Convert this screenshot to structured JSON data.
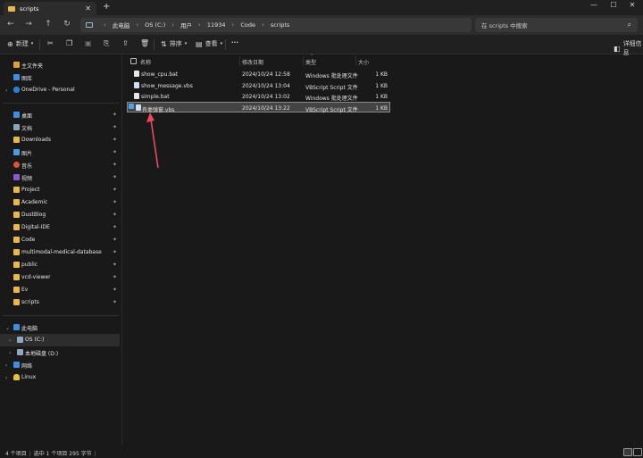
{
  "window": {
    "tab_title": "scripts",
    "new_tab": "+",
    "minimize": "—",
    "maximize": "☐",
    "close": "✕"
  },
  "nav": {
    "back": "←",
    "forward": "→",
    "up": "↑",
    "refresh": "↻"
  },
  "breadcrumb": [
    "此电脑",
    "OS (C:)",
    "用户",
    "11934",
    "Code",
    "scripts"
  ],
  "breadcrumb_sep": "›",
  "search": {
    "placeholder": "在 scripts 中搜索"
  },
  "toolbar": {
    "new_label": "新建",
    "sort_label": "排序",
    "view_label": "查看",
    "more_label": "···",
    "details_label": "详细信息"
  },
  "sidebar": {
    "quick": [
      {
        "label": "主文件夹",
        "icon": "home-icon",
        "color": "#e2a03a"
      },
      {
        "label": "图库",
        "icon": "gallery-icon",
        "color": "#3d8ee0"
      },
      {
        "label": "OneDrive - Personal",
        "icon": "cloud-icon",
        "color": "#2a7fd4"
      }
    ],
    "pinned": [
      {
        "label": "桌面",
        "icon": "desktop-icon",
        "color": "#3d8ee0"
      },
      {
        "label": "文档",
        "icon": "document-icon",
        "color": "#8aa3bf"
      },
      {
        "label": "Downloads",
        "icon": "folder-icon",
        "color": "#e8b84a"
      },
      {
        "label": "图片",
        "icon": "picture-icon",
        "color": "#4a9be0"
      },
      {
        "label": "音乐",
        "icon": "music-icon",
        "color": "#e0523a"
      },
      {
        "label": "视频",
        "icon": "video-icon",
        "color": "#8a5ad4"
      },
      {
        "label": "Project",
        "icon": "folder-icon",
        "color": "#e8b84a"
      },
      {
        "label": "Academic",
        "icon": "folder-icon",
        "color": "#e8b84a"
      },
      {
        "label": "DustBlog",
        "icon": "folder-icon",
        "color": "#e8b84a"
      },
      {
        "label": "Digital-IDE",
        "icon": "folder-icon",
        "color": "#e8b84a"
      },
      {
        "label": "Code",
        "icon": "folder-icon",
        "color": "#e8b84a"
      },
      {
        "label": "multimodal-medical-database",
        "icon": "folder-icon",
        "color": "#e8b84a"
      },
      {
        "label": "public",
        "icon": "folder-icon",
        "color": "#e8b84a"
      },
      {
        "label": "vcd-viewer",
        "icon": "folder-icon",
        "color": "#e8b84a"
      },
      {
        "label": "Ev",
        "icon": "folder-icon",
        "color": "#e8b84a"
      },
      {
        "label": "scripts",
        "icon": "folder-icon",
        "color": "#e8b84a"
      }
    ],
    "tree": [
      {
        "label": "此电脑",
        "icon": "pc-icon",
        "color": "#3d8ee0"
      },
      {
        "label": "OS (C:)",
        "icon": "drive-icon",
        "color": "#8fa8c0"
      },
      {
        "label": "本地磁盘 (D:)",
        "icon": "drive-icon",
        "color": "#8fa8c0"
      },
      {
        "label": "网络",
        "icon": "network-icon",
        "color": "#3d8ee0"
      },
      {
        "label": "Linux",
        "icon": "linux-icon",
        "color": "#e8c13a"
      }
    ],
    "pin_glyph": "📌"
  },
  "columns": {
    "name": "名称",
    "modified": "修改日期",
    "type": "类型",
    "size": "大小"
  },
  "files": [
    {
      "name": "show_cpu.bat",
      "modified": "2024/10/24 12:58",
      "type": "Windows 批处理文件",
      "size": "1 KB",
      "kind": "bat"
    },
    {
      "name": "show_message.vbs",
      "modified": "2024/10/24 13:04",
      "type": "VBScript Script 文件",
      "size": "1 KB",
      "kind": "vbs"
    },
    {
      "name": "simple.bat",
      "modified": "2024/10/24 13:02",
      "type": "Windows 批处理文件",
      "size": "1 KB",
      "kind": "bat"
    },
    {
      "name": "有类弹窗.vbs",
      "modified": "2024/10/24 13:22",
      "type": "VBScript Script 文件",
      "size": "1 KB",
      "kind": "vbs",
      "selected": true
    }
  ],
  "status": {
    "items": "4 个项目",
    "selection": "选中 1 个项目 295 字节"
  },
  "colors": {
    "accent": "#4fa3e3",
    "arrow": "#e84a5f",
    "selection_bg": "#444444"
  }
}
